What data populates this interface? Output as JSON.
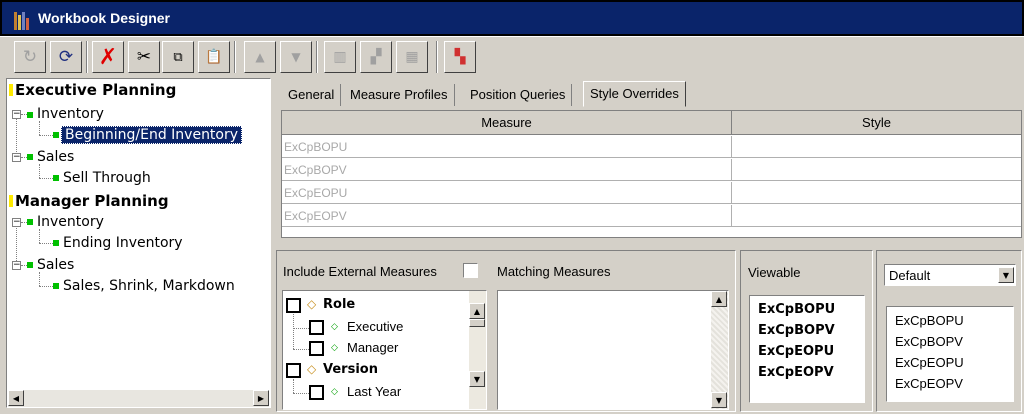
{
  "window": {
    "title": "Workbook Designer"
  },
  "tree": {
    "nodes": [
      {
        "label": "Executive Planning"
      },
      {
        "label": "Inventory"
      },
      {
        "label": "Beginning/End Inventory"
      },
      {
        "label": "Sales"
      },
      {
        "label": "Sell Through"
      },
      {
        "label": "Manager Planning"
      },
      {
        "label": "Inventory"
      },
      {
        "label": "Ending Inventory"
      },
      {
        "label": "Sales"
      },
      {
        "label": "Sales, Shrink, Markdown"
      }
    ],
    "selected": "Beginning/End Inventory"
  },
  "tabs": [
    {
      "label": "General"
    },
    {
      "label": "Measure Profiles"
    },
    {
      "label": "Position Queries"
    },
    {
      "label": "Style Overrides"
    }
  ],
  "active_tab": "Style Overrides",
  "grid": {
    "headers": [
      "Measure",
      "Style"
    ],
    "rows": [
      [
        "ExCpBOPU",
        ""
      ],
      [
        "ExCpBOPV",
        ""
      ],
      [
        "ExCpEOPU",
        ""
      ],
      [
        "ExCpEOPV",
        ""
      ]
    ]
  },
  "filters": {
    "include_external_label": "Include External Measures",
    "matching_label": "Matching Measures",
    "dims": [
      {
        "label": "Role"
      },
      {
        "label": "Executive"
      },
      {
        "label": "Manager"
      },
      {
        "label": "Version"
      },
      {
        "label": "Last Year"
      }
    ]
  },
  "viewable": {
    "label": "Viewable",
    "items": [
      "ExCpBOPU",
      "ExCpBOPV",
      "ExCpEOPU",
      "ExCpEOPV"
    ]
  },
  "style_select": {
    "value": "Default",
    "items": [
      "ExCpBOPU",
      "ExCpBOPV",
      "ExCpEOPU",
      "ExCpEOPV"
    ]
  },
  "colors": {
    "titlebar": "#0a246a",
    "selection": "#0a246a",
    "tree_box": "#00c000",
    "root_box": "#ffeb00"
  },
  "icons": [
    "redo-icon",
    "refresh-icon",
    "delete-icon",
    "cut-icon",
    "copy-icon",
    "paste-icon",
    "move-up-icon",
    "move-down-icon",
    "books-icon",
    "cards-icon",
    "grid-icon",
    "color-style-icon"
  ]
}
